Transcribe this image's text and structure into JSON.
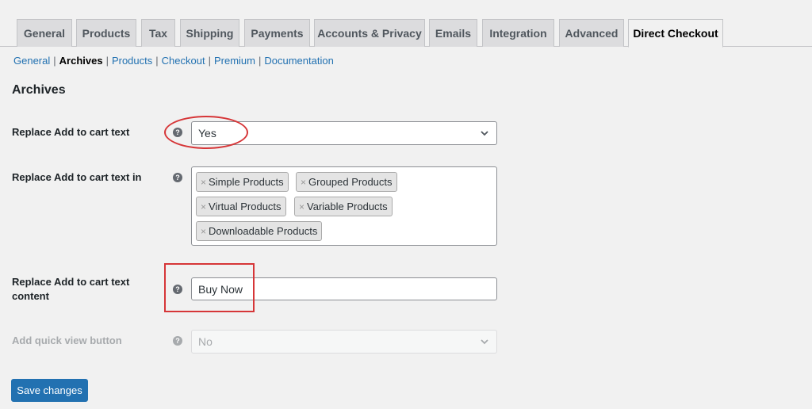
{
  "tabs": [
    {
      "label": "General",
      "active": false
    },
    {
      "label": "Products",
      "active": false
    },
    {
      "label": "Tax",
      "active": false
    },
    {
      "label": "Shipping",
      "active": false
    },
    {
      "label": "Payments",
      "active": false
    },
    {
      "label": "Accounts & Privacy",
      "active": false
    },
    {
      "label": "Emails",
      "active": false
    },
    {
      "label": "Integration",
      "active": false
    },
    {
      "label": "Advanced",
      "active": false
    },
    {
      "label": "Direct Checkout",
      "active": true
    }
  ],
  "subnav": {
    "items": [
      "General",
      "Archives",
      "Products",
      "Checkout",
      "Premium",
      "Documentation"
    ],
    "current": "Archives",
    "separator": "|"
  },
  "section": {
    "title": "Archives"
  },
  "fields": {
    "replace_text": {
      "label": "Replace Add to cart text",
      "value": "Yes"
    },
    "replace_text_in": {
      "label": "Replace Add to cart text in",
      "chips": [
        "Simple Products",
        "Grouped Products",
        "Virtual Products",
        "Variable Products",
        "Downloadable Products"
      ],
      "remove_glyph": "×"
    },
    "replace_text_content": {
      "label_line1": "Replace Add to cart text",
      "label_line2": "content",
      "value": "Buy Now"
    },
    "quick_view": {
      "label": "Add quick view button",
      "value": "No",
      "disabled": true
    }
  },
  "help_glyph": "?",
  "save_button": {
    "label": "Save changes"
  },
  "colors": {
    "accent": "#2271b1",
    "annotation": "#d63638",
    "background": "#f1f1f1"
  },
  "icons": {
    "help": "question-circle-icon",
    "dropdown": "chevron-down-icon",
    "remove": "close-icon"
  }
}
